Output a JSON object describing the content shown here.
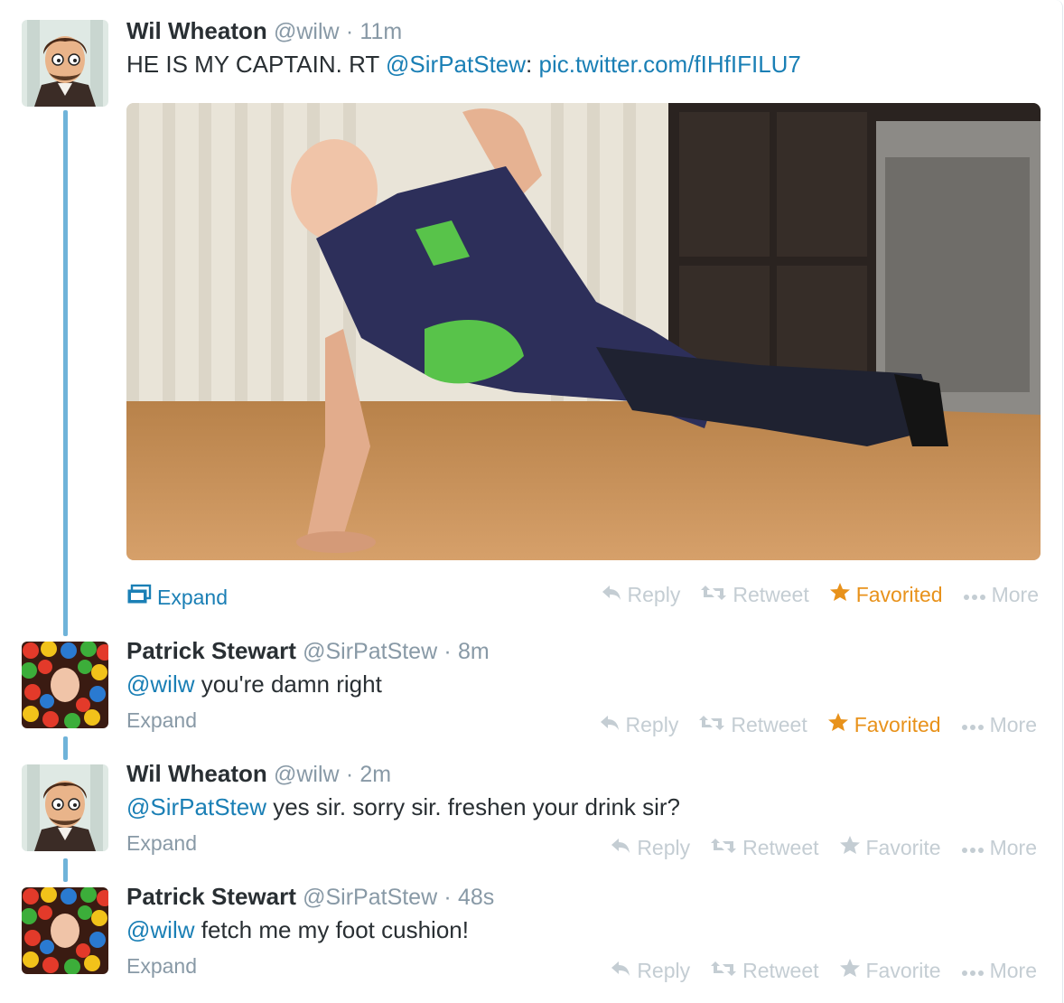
{
  "tweets": [
    {
      "name": "Wil Wheaton",
      "handle": "@wilw",
      "sep": "·",
      "time": "11m",
      "text_plain_1": "HE IS MY CAPTAIN. RT ",
      "mention": "@SirPatStew",
      "text_plain_2": ": ",
      "link": "pic.twitter.com/fIHfIFILU7",
      "expand": "Expand",
      "actions": {
        "reply": "Reply",
        "retweet": "Retweet",
        "favorite": "Favorited",
        "more": "More"
      }
    },
    {
      "name": "Patrick Stewart",
      "handle": "@SirPatStew",
      "sep": "·",
      "time": "8m",
      "mention": "@wilw",
      "text": " you're damn right",
      "expand": "Expand",
      "actions": {
        "reply": "Reply",
        "retweet": "Retweet",
        "favorite": "Favorited",
        "more": "More"
      }
    },
    {
      "name": "Wil Wheaton",
      "handle": "@wilw",
      "sep": "·",
      "time": "2m",
      "mention": "@SirPatStew",
      "text": " yes sir. sorry sir. freshen your drink sir?",
      "expand": "Expand",
      "actions": {
        "reply": "Reply",
        "retweet": "Retweet",
        "favorite": "Favorite",
        "more": "More"
      }
    },
    {
      "name": "Patrick Stewart",
      "handle": "@SirPatStew",
      "sep": "·",
      "time": "48s",
      "mention": "@wilw",
      "text": " fetch me my foot cushion!",
      "expand": "Expand",
      "actions": {
        "reply": "Reply",
        "retweet": "Retweet",
        "favorite": "Favorite",
        "more": "More"
      }
    }
  ],
  "colors": {
    "link": "#1a7fb5",
    "favorited": "#e8921b",
    "thread_line": "#6fb3d9",
    "muted": "#8899a6"
  },
  "icons": [
    "reply-icon",
    "retweet-icon",
    "star-icon",
    "more-dots-icon",
    "expand-media-icon"
  ]
}
